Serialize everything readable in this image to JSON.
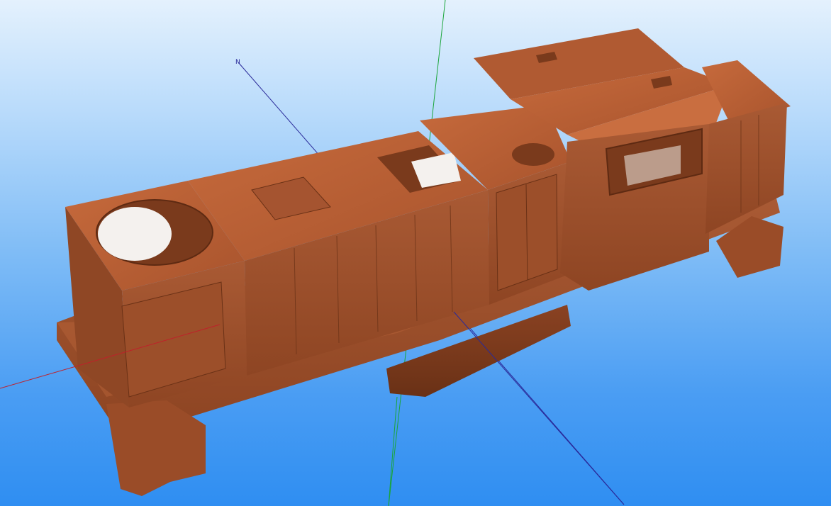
{
  "viewer": {
    "axis_label_n": "N"
  },
  "colors": {
    "background_top": "#e4f1fd",
    "background_bottom": "#2f8ef2",
    "model_base": "#b05a32",
    "model_light": "#c8683a",
    "model_shadow": "#7a3a1c",
    "axis_x": "#c0202a",
    "axis_y": "#1aa53a",
    "axis_z": "#2a2a9a"
  }
}
